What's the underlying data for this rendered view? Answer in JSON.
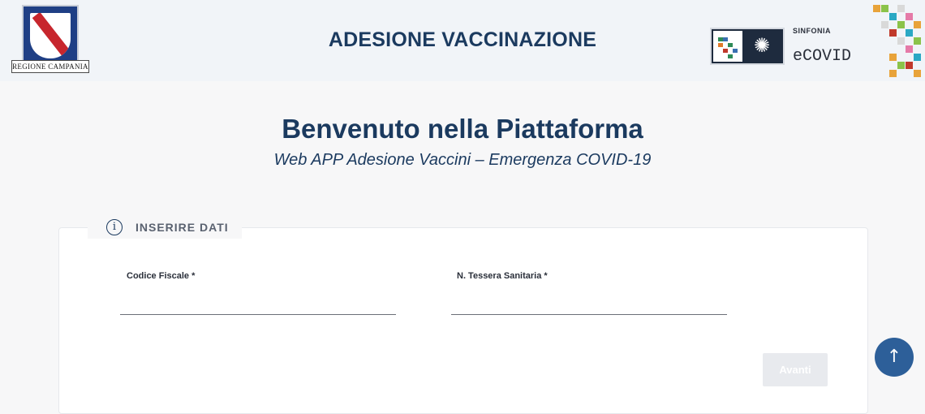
{
  "header": {
    "region_logo_text": "REGIONE CAMPANIA",
    "title": "ADESIONE VACCINAZIONE",
    "partner_small": "SINFONIA",
    "partner_name": "eCOVID"
  },
  "welcome": {
    "title": "Benvenuto nella Piattaforma",
    "subtitle": "Web APP Adesione Vaccini – Emergenza COVID-19"
  },
  "form": {
    "section_title": "INSERIRE DATI",
    "section_icon": "info-icon",
    "fields": [
      {
        "label": "Codice Fiscale *",
        "value": ""
      },
      {
        "label": "N. Tessera Sanitaria *",
        "value": ""
      }
    ],
    "submit_label": "Avanti"
  },
  "scroll_top_icon": "arrow-up-icon",
  "colors": {
    "primary": "#1b3a5f",
    "button_blue": "#2d5f99",
    "disabled_button": "#e8eaee"
  }
}
